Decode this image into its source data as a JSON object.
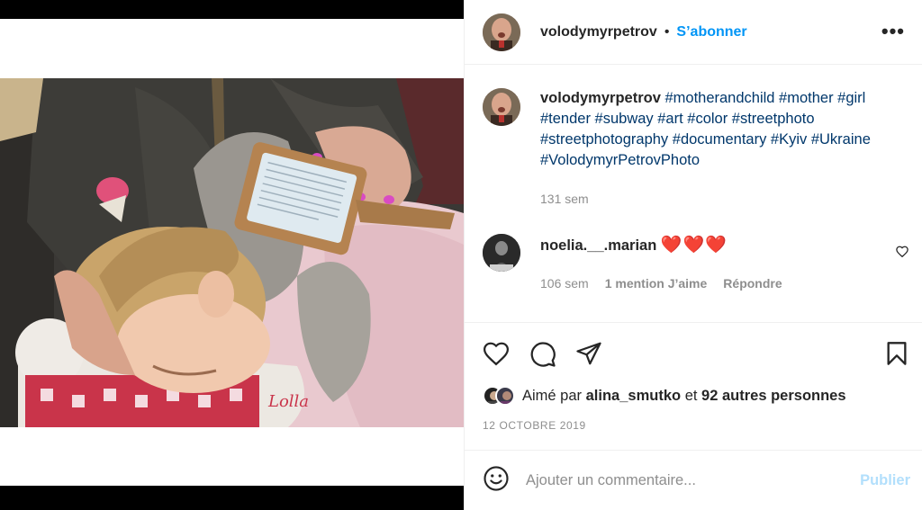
{
  "post": {
    "author": "volodymyrpetrov",
    "separator": "•",
    "follow_label": "S’abonner",
    "more_label": "•••",
    "photo_alt": "photo",
    "photo_brand_text": "Lolla"
  },
  "caption": {
    "author": "volodymyrpetrov",
    "hashtags": "#motherandchild #mother #girl #tender #subway #art #color #streetphoto #streetphotography #documentary #Kyiv #Ukraine #VolodymyrPetrovPhoto",
    "time": "131 sem"
  },
  "comment": {
    "author": "noelia.__.marian",
    "text": "❤️❤️❤️",
    "time": "106 sem",
    "likes": "1 mention J’aime",
    "reply": "Répondre"
  },
  "actions": {
    "like_icon": "heart-icon",
    "comment_icon": "speech-bubble-icon",
    "share_icon": "paper-plane-icon",
    "save_icon": "bookmark-icon"
  },
  "likes": {
    "prefix": "Aimé par",
    "user": "alina_smutko",
    "conjunction": "et",
    "others": "92 autres personnes"
  },
  "date": "12 OCTOBRE 2019",
  "composer": {
    "emoji_icon": "smiley-icon",
    "placeholder": "Ajouter un commentaire...",
    "publish_label": "Publier"
  },
  "colors": {
    "accent": "#0095f6",
    "publish_disabled": "#b2dffc",
    "hashtag": "#00376b",
    "muted": "#8e8e8e"
  }
}
